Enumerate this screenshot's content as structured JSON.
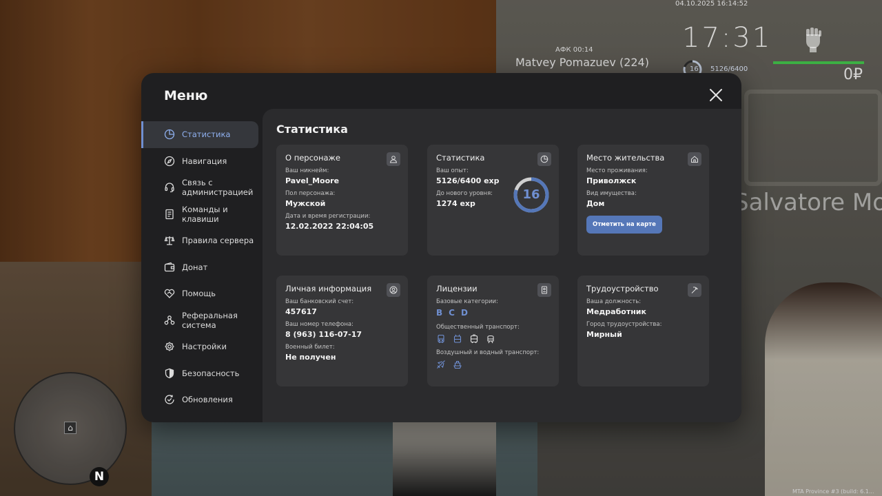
{
  "hud": {
    "datetime": "04.10.2025 16:14:52",
    "clock": "17:31",
    "level": "16",
    "exp": "5126/6400",
    "money": "0₽",
    "afk": "АФК 00:14",
    "player_name": "Matvey Pomazuev (224)",
    "world_text": "Salvatore Mor",
    "build_info": "MTA Province #3 (build: 6.1..."
  },
  "menu": {
    "title": "Меню",
    "sidebar": [
      {
        "label": "Статистика",
        "icon": "pie-chart-icon",
        "active": true
      },
      {
        "label": "Навигация",
        "icon": "compass-icon",
        "active": false
      },
      {
        "label": "Связь с администрацией",
        "icon": "headset-icon",
        "active": false
      },
      {
        "label": "Команды и клавиши",
        "icon": "document-icon",
        "active": false
      },
      {
        "label": "Правила сервера",
        "icon": "scales-icon",
        "active": false
      },
      {
        "label": "Донат",
        "icon": "wallet-icon",
        "active": false
      },
      {
        "label": "Помощь",
        "icon": "heart-handshake-icon",
        "active": false
      },
      {
        "label": "Реферальная система",
        "icon": "referral-icon",
        "active": false
      },
      {
        "label": "Настройки",
        "icon": "gear-icon",
        "active": false
      },
      {
        "label": "Безопасность",
        "icon": "shield-icon",
        "active": false
      },
      {
        "label": "Обновления",
        "icon": "update-check-icon",
        "active": false
      }
    ]
  },
  "content": {
    "title": "Статистика",
    "character": {
      "title": "О персонаже",
      "icon": "user-icon",
      "nickname_label": "Ваш никнейм:",
      "nickname": "Pavel_Moore",
      "gender_label": "Пол персонажа:",
      "gender": "Мужской",
      "reg_label": "Дата и время регистрации:",
      "reg_date": "12.02.2022 22:04:05"
    },
    "stats": {
      "title": "Статистика",
      "icon": "pie-chart-icon",
      "exp_label": "Ваш опыт:",
      "exp": "5126/6400 exp",
      "next_label": "До нового уровня:",
      "next": "1274 exp",
      "level": "16",
      "progress": 0.8
    },
    "residence": {
      "title": "Место жительства",
      "icon": "home-icon",
      "place_label": "Место проживания:",
      "place": "Приволжск",
      "property_label": "Вид имущества:",
      "property": "Дом",
      "map_button": "Отметить на карте"
    },
    "personal": {
      "title": "Личная информация",
      "icon": "user-circle-icon",
      "bank_label": "Ваш банковский счет:",
      "bank": "457617",
      "phone_label": "Ваш номер телефона:",
      "phone": "8 (963) 116-07-17",
      "military_label": "Военный билет:",
      "military": "Не получен"
    },
    "licenses": {
      "title": "Лицензии",
      "icon": "id-card-icon",
      "base_label": "Базовые категории:",
      "base": [
        "B",
        "C",
        "D"
      ],
      "public_label": "Общественный транспорт:",
      "public_icons": [
        "bus-icon",
        "trolleybus-icon",
        "tram-icon",
        "metro-icon"
      ],
      "air_label": "Воздушный и водный транспорт:",
      "air_icons": [
        "plane-icon",
        "boat-icon"
      ]
    },
    "job": {
      "title": "Трудоустройство",
      "icon": "pickaxe-icon",
      "position_label": "Ваша должность:",
      "position": "Медработник",
      "city_label": "Город трудоустройства:",
      "city": "Мирный"
    }
  }
}
